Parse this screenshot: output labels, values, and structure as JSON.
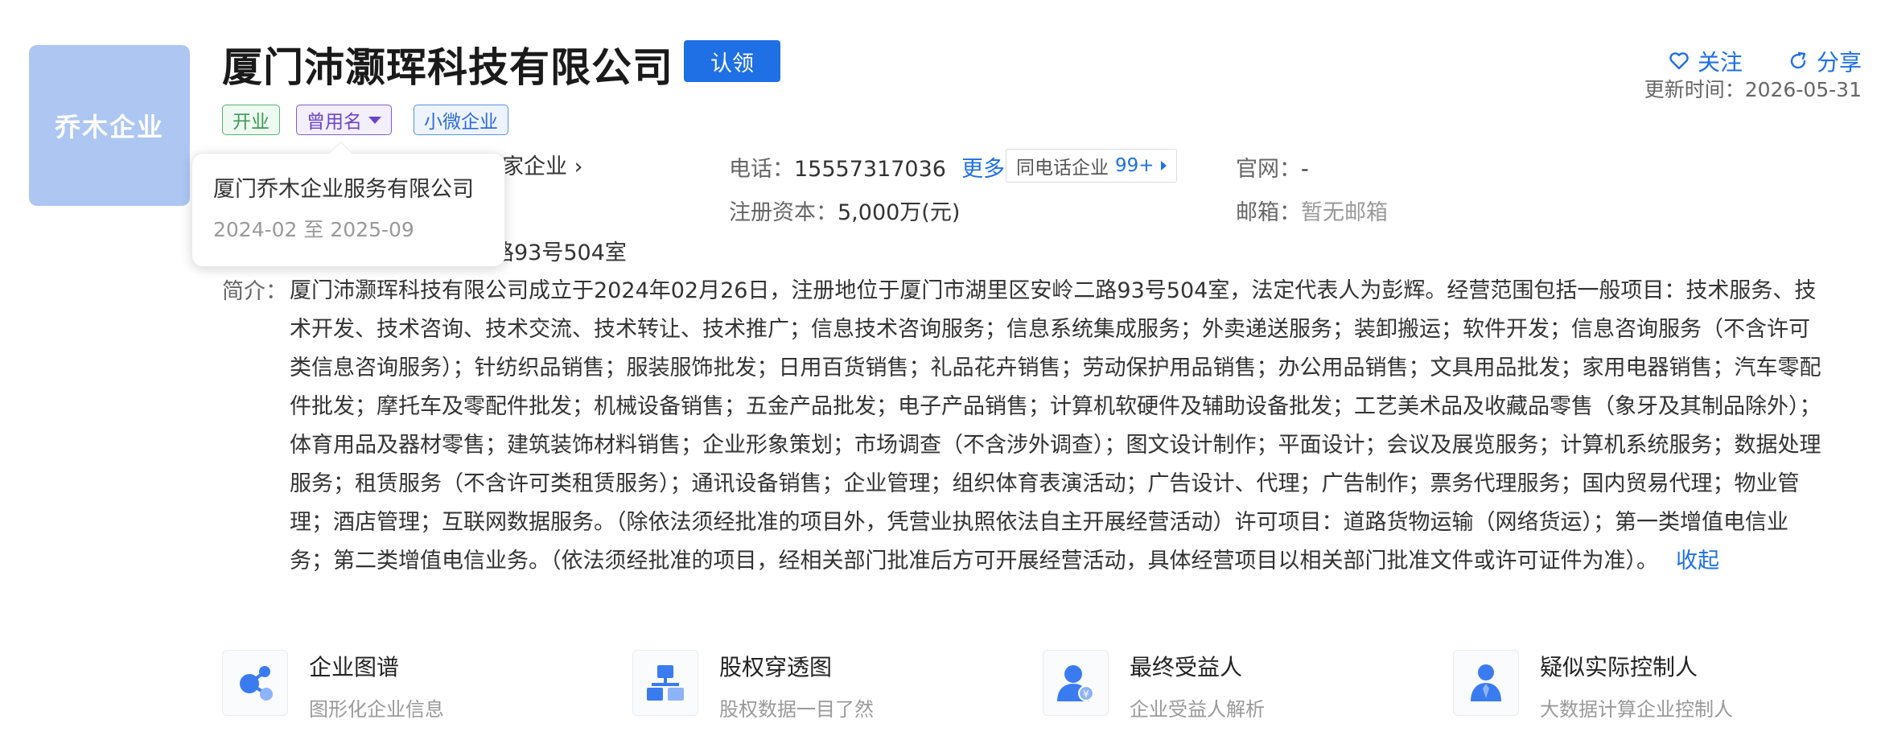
{
  "logo": {
    "text": "乔木企业",
    "bg": "#adc6f2"
  },
  "company": {
    "name": "厦门沛灏珲科技有限公司",
    "claim_label": "认领"
  },
  "tags": {
    "status": "开业",
    "former_name": "曾用名",
    "scale": "小微企业"
  },
  "actions": {
    "follow": "关注",
    "share": "分享"
  },
  "update_time": "更新时间：2026-05-31",
  "popover": {
    "name": "厦门乔木企业服务有限公司",
    "period": "2024-02 至 2025-09"
  },
  "info": {
    "legal_partial": "家企业",
    "address_partial": "路93号504室",
    "phone_label": "电话：",
    "phone_value": "15557317036",
    "phone_more": "更多",
    "same_phone_label": "同电话企业",
    "same_phone_count": "99+",
    "capital_label": "注册资本：",
    "capital_value": "5,000万(元)",
    "website_label": "官网：",
    "website_value": "-",
    "email_label": "邮箱：",
    "email_value": "暂无邮箱"
  },
  "description": {
    "label": "简介：",
    "text": "厦门沛灏珲科技有限公司成立于2024年02月26日，注册地位于厦门市湖里区安岭二路93号504室，法定代表人为彭辉。经营范围包括一般项目：技术服务、技术开发、技术咨询、技术交流、技术转让、技术推广；信息技术咨询服务；信息系统集成服务；外卖递送服务；装卸搬运；软件开发；信息咨询服务（不含许可类信息咨询服务）；针纺织品销售；服装服饰批发；日用百货销售；礼品花卉销售；劳动保护用品销售；办公用品销售；文具用品批发；家用电器销售；汽车零配件批发；摩托车及零配件批发；机械设备销售；五金产品批发；电子产品销售；计算机软硬件及辅助设备批发；工艺美术品及收藏品零售（象牙及其制品除外）；体育用品及器材零售；建筑装饰材料销售；企业形象策划；市场调查（不含涉外调查）；图文设计制作；平面设计；会议及展览服务；计算机系统服务；数据处理服务；租赁服务（不含许可类租赁服务）；通讯设备销售；企业管理；组织体育表演活动；广告设计、代理；广告制作；票务代理服务；国内贸易代理；物业管理；酒店管理；互联网数据服务。（除依法须经批准的项目外，凭营业执照依法自主开展经营活动）许可项目：道路货物运输（网络货运）；第一类增值电信业务；第二类增值电信业务。（依法须经批准的项目，经相关部门批准后方可开展经营活动，具体经营项目以相关部门批准文件或许可证件为准）。",
    "collapse": "收起"
  },
  "features": [
    {
      "title": "企业图谱",
      "subtitle": "图形化企业信息",
      "icon": "graph-icon"
    },
    {
      "title": "股权穿透图",
      "subtitle": "股权数据一目了然",
      "icon": "equity-tree-icon"
    },
    {
      "title": "最终受益人",
      "subtitle": "企业受益人解析",
      "icon": "beneficiary-icon"
    },
    {
      "title": "疑似实际控制人",
      "subtitle": "大数据计算企业控制人",
      "icon": "controller-icon"
    }
  ],
  "colors": {
    "accent": "#1f6fe5",
    "icon_blue": "#3a7bf0"
  }
}
